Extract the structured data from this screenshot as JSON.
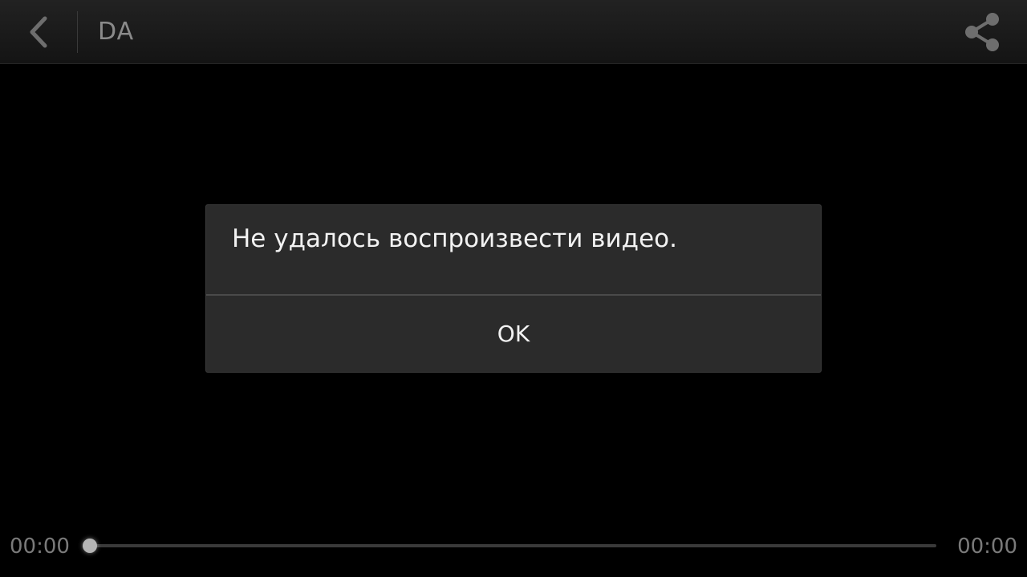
{
  "action_bar": {
    "title": "DA",
    "back_icon": "chevron-left-icon",
    "share_icon": "share-icon"
  },
  "dialog": {
    "message": "Не удалось воспроизвести видео.",
    "ok_label": "OK"
  },
  "player": {
    "current_time": "00:00",
    "total_time": "00:00",
    "progress": 0
  },
  "colors": {
    "background": "#000000",
    "action_bar": "#1b1b1b",
    "dialog_background": "#2b2b2b",
    "text_primary": "#f2f2f2",
    "text_secondary": "#8a8a8a"
  }
}
